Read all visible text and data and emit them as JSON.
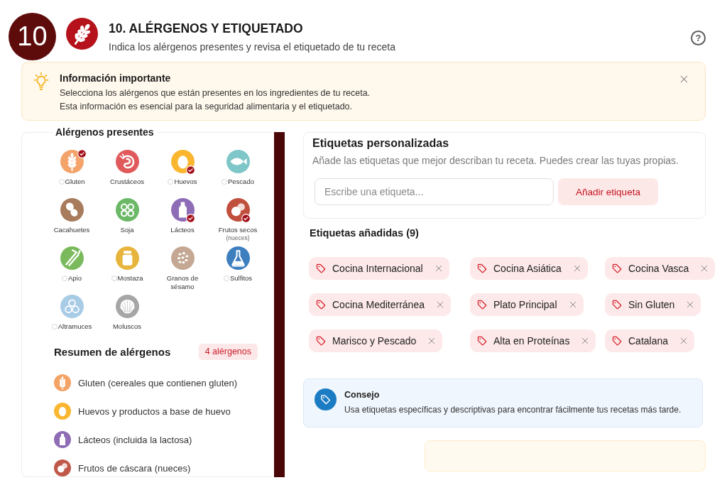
{
  "header": {
    "step_number": "10",
    "title": "10. ALÉRGENOS Y ETIQUETADO",
    "subtitle": "Indica los alérgenos presentes y revisa el etiquetado de tu receta",
    "help": "?"
  },
  "info_banner": {
    "title": "Información importante",
    "lines": [
      "Selecciona los alérgenos que están presentes en los ingredientes de tu receta.",
      "Esta información es esencial para la seguridad alimentaria y el etiquetado."
    ]
  },
  "allergens_panel": {
    "title": "Alérgenos presentes",
    "items": [
      {
        "kind": "gluten",
        "label": "Gluten",
        "color": "#f4a36b",
        "checked": true,
        "radio": true
      },
      {
        "kind": "crustaceans",
        "label": "Crustáceos",
        "color": "#e05a5c",
        "checked": false,
        "radio": false
      },
      {
        "kind": "eggs",
        "label": "Huevos",
        "color": "#fbb62f",
        "checked": true,
        "radio": true
      },
      {
        "kind": "fish",
        "label": "Pescado",
        "color": "#7fc6c8",
        "checked": false,
        "radio": true
      },
      {
        "kind": "peanuts",
        "label": "Cacahuetes",
        "color": "#a87b5c",
        "checked": false,
        "radio": false
      },
      {
        "kind": "soy",
        "label": "Soja",
        "color": "#6bb866",
        "checked": false,
        "radio": false
      },
      {
        "kind": "milk",
        "label": "Lácteos",
        "color": "#8e6cb6",
        "checked": true,
        "radio": false
      },
      {
        "kind": "nuts",
        "label": "Frutos secos",
        "note": "(nueces)",
        "color": "#c04f3e",
        "checked": true,
        "radio": false
      },
      {
        "kind": "celery",
        "label": "Apio",
        "color": "#7aba5c",
        "checked": false,
        "radio": true
      },
      {
        "kind": "mustard",
        "label": "Mostaza",
        "color": "#e8b53c",
        "checked": false,
        "radio": true
      },
      {
        "kind": "sesame",
        "label": "Granos de sésamo",
        "color": "#c4a893",
        "checked": false,
        "radio": false
      },
      {
        "kind": "sulphites",
        "label": "Sulfitos",
        "color": "#3d7ebf",
        "checked": false,
        "radio": true
      },
      {
        "kind": "lupin",
        "label": "Altramuces",
        "color": "#a8cbe6",
        "checked": false,
        "radio": true
      },
      {
        "kind": "molluscs",
        "label": "Moluscos",
        "color": "#a6a6a6",
        "checked": false,
        "radio": false
      }
    ]
  },
  "summary": {
    "title": "Resumen de alérgenos",
    "count_badge": "4 alérgenos",
    "items": [
      {
        "kind": "gluten",
        "color": "#f4a366",
        "text": "Gluten (cereales que contienen gluten)"
      },
      {
        "kind": "eggs",
        "color": "#fbb62f",
        "text": "Huevos y productos a base de huevo"
      },
      {
        "kind": "milk",
        "color": "#8e6cb6",
        "text": "Lácteos (incluida la lactosa)"
      },
      {
        "kind": "nuts",
        "color": "#c0584a",
        "text": "Frutos de cáscara (nueces)"
      }
    ]
  },
  "custom_tags": {
    "title": "Etiquetas personalizadas",
    "description": "Añade las etiquetas que mejor describan tu receta. Puedes crear las tuyas propias.",
    "input": {
      "placeholder": "Escribe una etiqueta..."
    },
    "add_button": "Añadir etiqueta"
  },
  "added_tags": {
    "title": "Etiquetas añadidas (9)",
    "tags": [
      "Cocina Internacional",
      "Cocina Asiática",
      "Cocina Vasca",
      "Cocina Mediterránea",
      "Plato Principal",
      "Sin Gluten",
      "Marisco y Pescado",
      "Alta en Proteínas",
      "Catalana"
    ]
  },
  "tip": {
    "title": "Consejo",
    "text": "Usa etiquetas específicas y descriptivas para encontrar fácilmente tus recetas más tarde."
  }
}
